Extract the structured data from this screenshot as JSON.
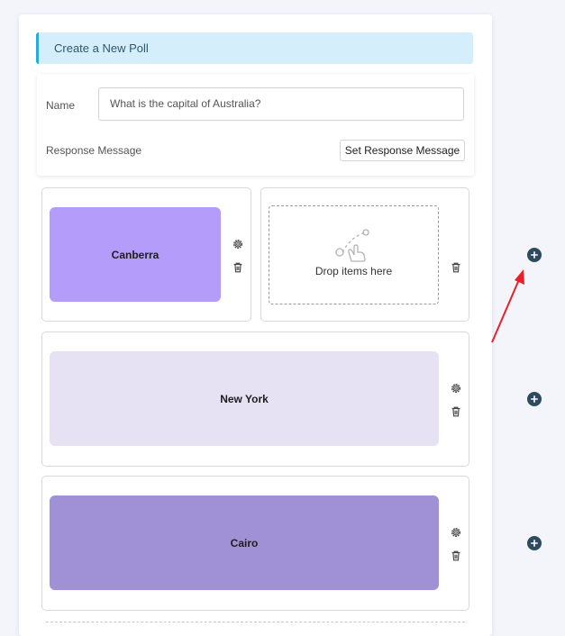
{
  "poll": {
    "header_title": "Create a New Poll",
    "name_label": "Name",
    "name_value": "What is the capital of Australia?",
    "response_label": "Response Message",
    "response_button": "Set Response Message"
  },
  "options": [
    {
      "label": "Canberra",
      "color": "#b49cfa"
    },
    {
      "label": "New York",
      "color": "#e6e2f4"
    },
    {
      "label": "Cairo",
      "color": "#a091d6"
    }
  ],
  "dropzone": {
    "text": "Drop items here"
  },
  "icons": {
    "settings": "gear-icon",
    "delete": "trash-icon",
    "add": "plus-circle-icon",
    "drop": "drag-hand-icon"
  },
  "colors": {
    "header_bg": "#d4eefc",
    "header_accent": "#29a9e0",
    "add_button": "#2e4a5e",
    "annotation_arrow": "#e8202a"
  }
}
